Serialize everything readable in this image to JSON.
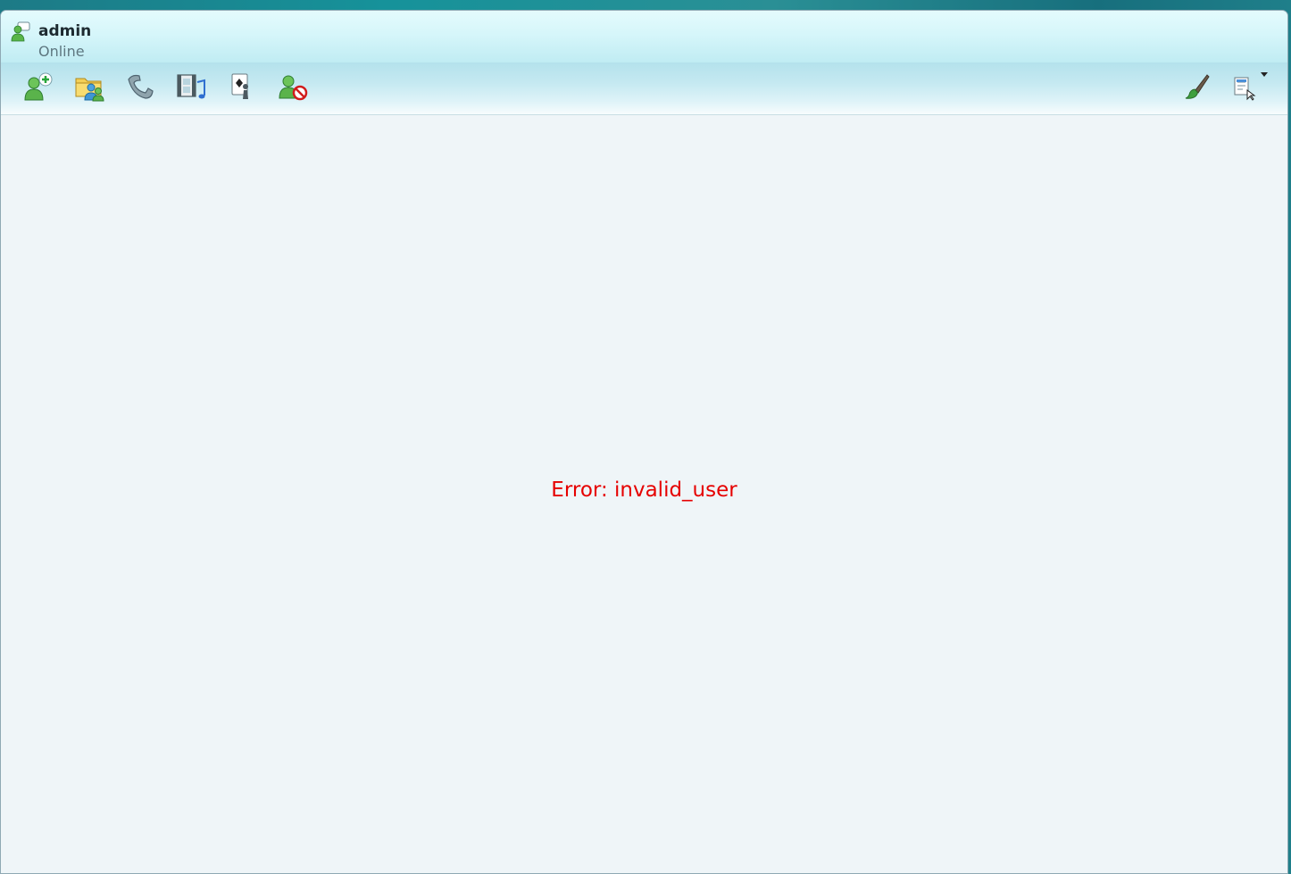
{
  "user": {
    "name": "admin",
    "status": "Online"
  },
  "toolbar": {
    "left_buttons": [
      {
        "icon": "add-contact-icon"
      },
      {
        "icon": "share-folder-icon"
      },
      {
        "icon": "phone-call-icon"
      },
      {
        "icon": "video-audio-icon"
      },
      {
        "icon": "games-icon"
      },
      {
        "icon": "block-contact-icon"
      }
    ],
    "right_buttons": [
      {
        "icon": "paintbrush-icon"
      },
      {
        "icon": "menu-dropdown-icon"
      }
    ]
  },
  "main": {
    "error_message": "Error: invalid_user"
  },
  "colors": {
    "error": "#e60000",
    "background": "#eff5f8",
    "toolbar": "#c5e9f1"
  }
}
